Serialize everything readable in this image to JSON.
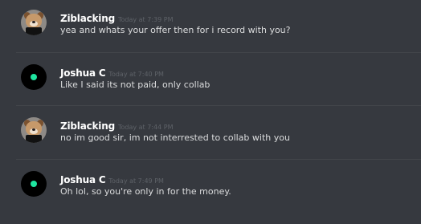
{
  "messages": [
    {
      "author": "Ziblacking",
      "timestamp": "Today at 7:39 PM",
      "text": "yea and whats your offer then for i record with you?"
    },
    {
      "author": "Joshua C",
      "timestamp": "Today at 7:40 PM",
      "text": "Like I said its not paid, only collab"
    },
    {
      "author": "Ziblacking",
      "timestamp": "Today at 7:44 PM",
      "text": "no im good sir, im not interrested to collab with you"
    },
    {
      "author": "Joshua C",
      "timestamp": "Today at 7:49 PM",
      "text": "Oh lol, so you're only in for the money."
    }
  ],
  "colors": {
    "background": "#36393f",
    "username": "#ffffff",
    "message_text": "#dcddde",
    "timestamp": "#5e6268",
    "divider": "#42454a",
    "status_dot": "#1fe5a0"
  },
  "avatars": {
    "ziblacking": "dog-avatar-icon",
    "joshua_c": "black-avatar-icon"
  }
}
